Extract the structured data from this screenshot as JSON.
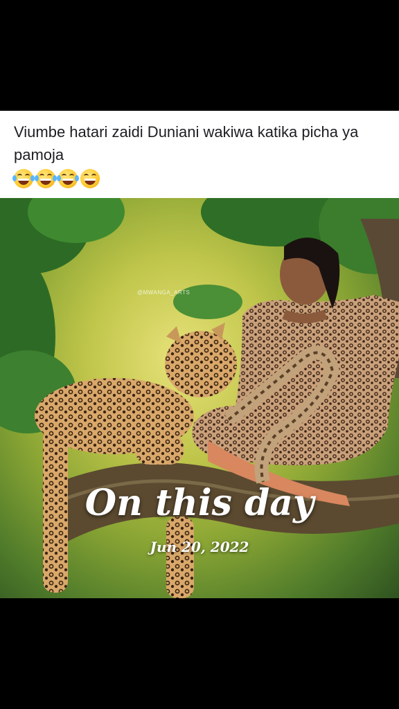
{
  "post": {
    "caption": "Viumbe hatari zaidi Duniani wakiwa katika picha ya pamoja",
    "emojis": [
      "tears-of-joy-emoji",
      "tears-of-joy-emoji",
      "tears-of-joy-emoji",
      "grinning-emoji"
    ]
  },
  "photo": {
    "watermark": "@MWANGA_ARTS"
  },
  "memory": {
    "title": "On this day",
    "date": "Jun 20, 2022"
  }
}
